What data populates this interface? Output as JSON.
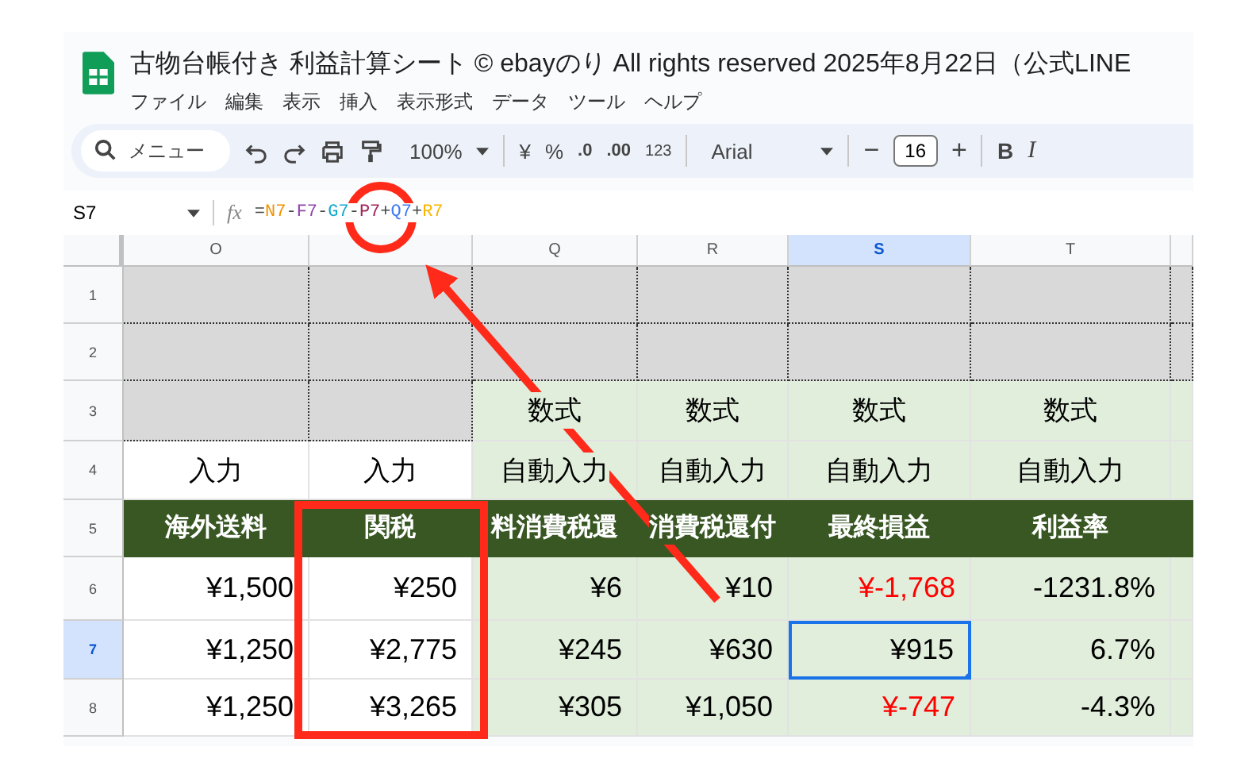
{
  "title": "古物台帳付き 利益計算シート © ebayのり All rights reserved  2025年8月22日（公式LINE",
  "menu": [
    "ファイル",
    "編集",
    "表示",
    "挿入",
    "表示形式",
    "データ",
    "ツール",
    "ヘルプ"
  ],
  "toolbar": {
    "search_placeholder": "メニュー",
    "zoom": "100%",
    "currency": "¥",
    "percent": "%",
    "decrease_decimal": ".0",
    "increase_decimal": ".00",
    "number_format": "123",
    "font": "Arial",
    "minus": "−",
    "font_size": "16",
    "plus": "+",
    "bold": "B",
    "italic": "I"
  },
  "name_box": "S7",
  "function_label": "fx",
  "formula": [
    {
      "text": "=",
      "color": "#444746"
    },
    {
      "text": "N7",
      "color": "#f09300"
    },
    {
      "text": "-",
      "color": "#444746"
    },
    {
      "text": "F7",
      "color": "#8e44ad"
    },
    {
      "text": "-",
      "color": "#444746"
    },
    {
      "text": "G7",
      "color": "#11a9cc"
    },
    {
      "text": "-",
      "color": "#444746"
    },
    {
      "text": "P7",
      "color": "#a0235a"
    },
    {
      "text": "+",
      "color": "#444746"
    },
    {
      "text": "Q7",
      "color": "#3d7af5"
    },
    {
      "text": "+",
      "color": "#444746"
    },
    {
      "text": "R7",
      "color": "#f7b500"
    }
  ],
  "columns": [
    {
      "label": "O",
      "selected": false
    },
    {
      "selected": false
    },
    {
      "label": "Q",
      "selected": false
    },
    {
      "label": "R",
      "selected": false
    },
    {
      "label": "S",
      "selected": true
    },
    {
      "label": "T",
      "selected": false
    },
    {
      "selected": false
    }
  ],
  "rows": [
    {
      "number": "1",
      "selected": false,
      "cells": [
        {
          "kind": "gray"
        },
        {
          "kind": "gray"
        },
        {
          "kind": "gray"
        },
        {
          "kind": "gray"
        },
        {
          "kind": "gray"
        },
        {
          "kind": "gray"
        },
        {
          "kind": "gray"
        }
      ]
    },
    {
      "number": "2",
      "selected": false,
      "cells": [
        {
          "kind": "gray"
        },
        {
          "kind": "gray"
        },
        {
          "kind": "gray"
        },
        {
          "kind": "gray"
        },
        {
          "kind": "gray"
        },
        {
          "kind": "gray"
        },
        {
          "kind": "gray"
        }
      ]
    },
    {
      "number": "3",
      "selected": false,
      "cells": [
        {
          "kind": "gray"
        },
        {
          "kind": "gray"
        },
        {
          "kind": "green",
          "text": "数式"
        },
        {
          "kind": "green",
          "text": "数式"
        },
        {
          "kind": "green",
          "text": "数式"
        },
        {
          "kind": "green",
          "text": "数式"
        },
        {
          "kind": "green"
        }
      ]
    },
    {
      "number": "4",
      "selected": false,
      "cells": [
        {
          "kind": "white",
          "text": "入力"
        },
        {
          "kind": "white",
          "text": "入力"
        },
        {
          "kind": "green",
          "text": "自動入力"
        },
        {
          "kind": "green",
          "text": "自動入力"
        },
        {
          "kind": "green",
          "text": "自動入力"
        },
        {
          "kind": "green",
          "text": "自動入力"
        },
        {
          "kind": "green"
        }
      ]
    },
    {
      "number": "5",
      "selected": false,
      "cells": [
        {
          "kind": "header",
          "text": "海外送料"
        },
        {
          "kind": "header",
          "text": "関税"
        },
        {
          "kind": "header",
          "text": "料消費税還"
        },
        {
          "kind": "header",
          "text": "消費税還付"
        },
        {
          "kind": "header",
          "text": "最終損益"
        },
        {
          "kind": "header",
          "text": "利益率"
        },
        {
          "kind": "header"
        }
      ]
    },
    {
      "number": "6",
      "selected": false,
      "cells": [
        {
          "kind": "white-value",
          "text": "¥1,500",
          "negative": false
        },
        {
          "kind": "white-value",
          "text": "¥250",
          "negative": false
        },
        {
          "kind": "green-value",
          "text": "¥6",
          "negative": false
        },
        {
          "kind": "green-value",
          "text": "¥10",
          "negative": false
        },
        {
          "kind": "green-value",
          "text": "¥-1,768",
          "negative": true
        },
        {
          "kind": "green-value",
          "text": "-1231.8%",
          "negative": false
        },
        {
          "kind": "green"
        }
      ]
    },
    {
      "number": "7",
      "selected": true,
      "cells": [
        {
          "kind": "white-value",
          "text": "¥1,250",
          "negative": false
        },
        {
          "kind": "white-value",
          "text": "¥2,775",
          "negative": false
        },
        {
          "kind": "green-value",
          "text": "¥245",
          "negative": false
        },
        {
          "kind": "green-value",
          "text": "¥630",
          "negative": false
        },
        {
          "kind": "green-value",
          "text": "¥915",
          "negative": false,
          "selected": true
        },
        {
          "kind": "green-value",
          "text": "6.7%",
          "negative": false
        },
        {
          "kind": "green"
        }
      ]
    },
    {
      "number": "8",
      "selected": false,
      "cells": [
        {
          "kind": "white-value",
          "text": "¥1,250",
          "negative": false
        },
        {
          "kind": "white-value",
          "text": "¥3,265",
          "negative": false
        },
        {
          "kind": "green-value",
          "text": "¥305",
          "negative": false
        },
        {
          "kind": "green-value",
          "text": "¥1,050",
          "negative": false
        },
        {
          "kind": "green-value",
          "text": "¥-747",
          "negative": true
        },
        {
          "kind": "green-value",
          "text": "-4.3%",
          "negative": false
        },
        {
          "kind": "green"
        }
      ]
    }
  ],
  "annotations": [
    {
      "kind": "circle"
    },
    {
      "kind": "arrow"
    },
    {
      "kind": "rect"
    }
  ]
}
